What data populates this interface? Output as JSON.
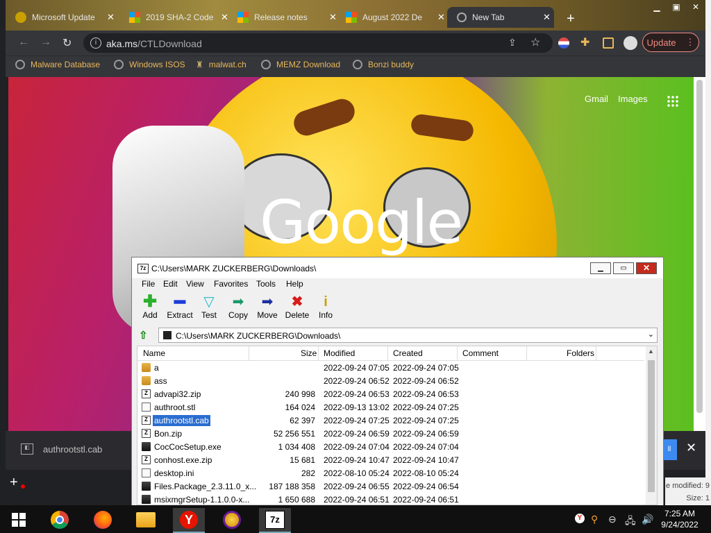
{
  "browser": {
    "tabs": [
      {
        "label": "Microsoft Update",
        "active": false
      },
      {
        "label": "2019 SHA-2 Code",
        "active": false
      },
      {
        "label": "Release notes",
        "active": false
      },
      {
        "label": "August 2022 De",
        "active": false
      },
      {
        "label": "New Tab",
        "active": true
      }
    ],
    "address": {
      "domain": "aka.ms",
      "path": "/CTLDownload"
    },
    "update_label": "Update",
    "bookmarks": [
      "Malware Database",
      "Windows ISOS",
      "malwat.ch",
      "MEMZ Download",
      "Bonzi buddy"
    ],
    "links": {
      "gmail": "Gmail",
      "images": "Images"
    },
    "google_logo": "Google",
    "download": {
      "file": "authrootstl.cab"
    }
  },
  "zip": {
    "title": "C:\\Users\\MARK ZUCKERBERG\\Downloads\\",
    "menu": [
      "File",
      "Edit",
      "View",
      "Favorites",
      "Tools",
      "Help"
    ],
    "tools": [
      {
        "label": "Add",
        "icon": "add-icon",
        "color": "#2bb02b"
      },
      {
        "label": "Extract",
        "icon": "extract-icon",
        "color": "#1b3bd8"
      },
      {
        "label": "Test",
        "icon": "test-icon",
        "color": "#27b7c8"
      },
      {
        "label": "Copy",
        "icon": "copy-icon",
        "color": "#1a9a6a"
      },
      {
        "label": "Move",
        "icon": "move-icon",
        "color": "#1b2fa0"
      },
      {
        "label": "Delete",
        "icon": "delete-icon",
        "color": "#d81b1b"
      },
      {
        "label": "Info",
        "icon": "info-icon",
        "color": "#c8a000"
      }
    ],
    "path": "C:\\Users\\MARK ZUCKERBERG\\Downloads\\",
    "columns": [
      "Name",
      "Size",
      "Modified",
      "Created",
      "Comment",
      "Folders"
    ],
    "files": [
      {
        "name": "a",
        "size": "",
        "modified": "2022-09-24 07:05",
        "created": "2022-09-24 07:05",
        "type": "folder"
      },
      {
        "name": "ass",
        "size": "",
        "modified": "2022-09-24 06:52",
        "created": "2022-09-24 06:52",
        "type": "folder"
      },
      {
        "name": "advapi32.zip",
        "size": "240 998",
        "modified": "2022-09-24 06:53",
        "created": "2022-09-24 06:53",
        "type": "zip"
      },
      {
        "name": "authroot.stl",
        "size": "164 024",
        "modified": "2022-09-13 13:02",
        "created": "2022-09-24 07:25",
        "type": "file"
      },
      {
        "name": "authrootstl.cab",
        "size": "62 397",
        "modified": "2022-09-24 07:25",
        "created": "2022-09-24 07:25",
        "type": "zip",
        "selected": true
      },
      {
        "name": "Bon.zip",
        "size": "52 256 551",
        "modified": "2022-09-24 06:59",
        "created": "2022-09-24 06:59",
        "type": "zip"
      },
      {
        "name": "CocCocSetup.exe",
        "size": "1 034 408",
        "modified": "2022-09-24 07:04",
        "created": "2022-09-24 07:04",
        "type": "exe"
      },
      {
        "name": "conhost.exe.zip",
        "size": "15 681",
        "modified": "2022-09-24 10:47",
        "created": "2022-09-24 10:47",
        "type": "zip"
      },
      {
        "name": "desktop.ini",
        "size": "282",
        "modified": "2022-08-10 05:24",
        "created": "2022-08-10 05:24",
        "type": "file"
      },
      {
        "name": "Files.Package_2.3.11.0_x...",
        "size": "187 188 358",
        "modified": "2022-09-24 06:55",
        "created": "2022-09-24 06:54",
        "type": "exe"
      },
      {
        "name": "msixmgrSetup-1.1.0.0-x...",
        "size": "1 650 688",
        "modified": "2022-09-24 06:51",
        "created": "2022-09-24 06:51",
        "type": "exe"
      }
    ]
  },
  "behind": {
    "line1": "e modified: 9",
    "line2": "Size: 1"
  },
  "taskbar": {
    "time": "7:25 AM",
    "date": "9/24/2022"
  }
}
